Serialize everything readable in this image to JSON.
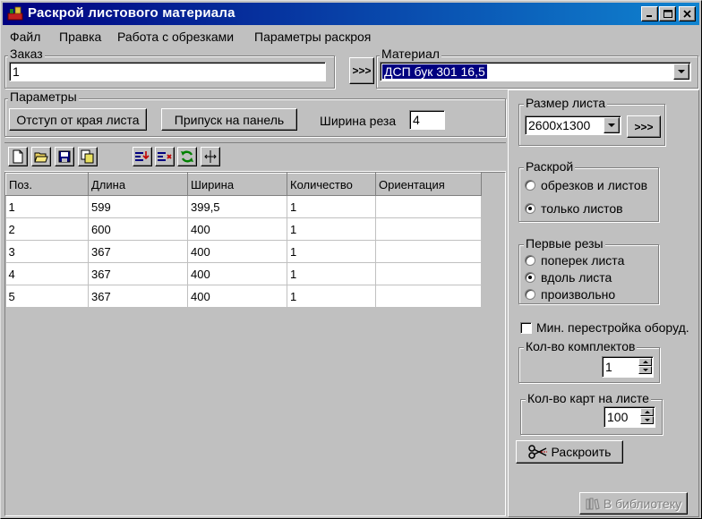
{
  "window": {
    "title": "Раскрой листового материала"
  },
  "caption_buttons": {
    "minimize": "_",
    "maximize": "□",
    "close": "×"
  },
  "menu": [
    "Файл",
    "Правка",
    "Работа с обрезками",
    "Параметры раскроя"
  ],
  "order": {
    "label": "Заказ",
    "value": "1"
  },
  "arrow_button": ">>>",
  "material": {
    "label": "Материал",
    "value": "ДСП бук 301 16,5"
  },
  "params": {
    "label": "Параметры",
    "offset_button": "Отступ от края листа",
    "allowance_button": "Припуск на панель",
    "kerf_label": "Ширина реза",
    "kerf_value": "4"
  },
  "toolbar": [
    "new-doc-icon",
    "open-folder-icon",
    "save-disk-icon",
    "copy-icon",
    "insert-row-icon",
    "delete-row-icon",
    "refresh-icon",
    "split-icon"
  ],
  "table": {
    "columns": [
      "Поз.",
      "Длина",
      "Ширина",
      "Количество",
      "Ориентация"
    ],
    "rows": [
      [
        "1",
        "599",
        "399,5",
        "1",
        ""
      ],
      [
        "2",
        "600",
        "400",
        "1",
        ""
      ],
      [
        "3",
        "367",
        "400",
        "1",
        ""
      ],
      [
        "4",
        "367",
        "400",
        "1",
        ""
      ],
      [
        "5",
        "367",
        "400",
        "1",
        ""
      ]
    ]
  },
  "sheet_size": {
    "label": "Размер листа",
    "value": "2600x1300",
    "button": ">>>"
  },
  "cutting": {
    "label": "Раскрой",
    "options": [
      "обрезков и листов",
      "только листов"
    ],
    "selected": 1
  },
  "first_cuts": {
    "label": "Первые резы",
    "options": [
      "поперек листа",
      "вдоль листа",
      "произвольно"
    ],
    "selected": 1
  },
  "min_rebuild": {
    "label": "Мин. перестройка оборуд.",
    "checked": false
  },
  "kits": {
    "label": "Кол-во комплектов",
    "value": "1"
  },
  "cards_per_sheet": {
    "label": "Кол-во карт на листе",
    "value": "100"
  },
  "cut_button": "Раскроить",
  "library_button": "В библиотеку"
}
